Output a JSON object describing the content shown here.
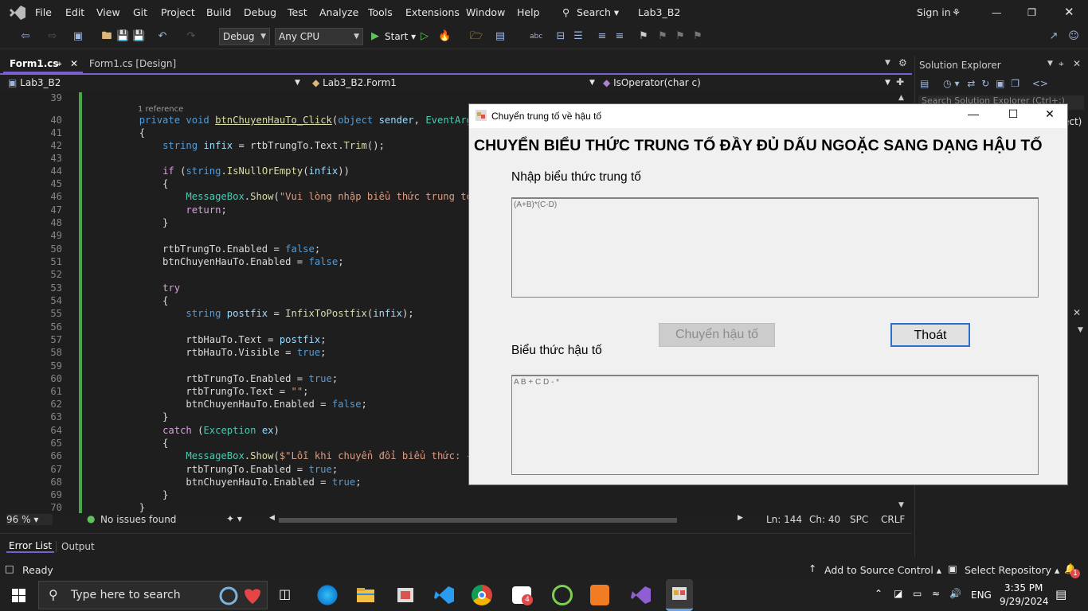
{
  "menubar": {
    "items": [
      "File",
      "Edit",
      "View",
      "Git",
      "Project",
      "Build",
      "Debug",
      "Test",
      "Analyze",
      "Tools",
      "Extensions",
      "Window",
      "Help"
    ],
    "search_label": "Search",
    "solution_name": "Lab3_B2",
    "sign_in": "Sign in"
  },
  "toolbar": {
    "config": "Debug",
    "platform": "Any CPU",
    "start_label": "Start"
  },
  "tabs": {
    "active": "Form1.cs",
    "inactive": "Form1.cs [Design]"
  },
  "nav": {
    "project": "Lab3_B2",
    "class": "Lab3_B2.Form1",
    "member": "IsOperator(char c)"
  },
  "editor": {
    "reference_hint": "1 reference",
    "line_numbers": [
      "39",
      "40",
      "41",
      "42",
      "43",
      "44",
      "45",
      "46",
      "47",
      "48",
      "49",
      "50",
      "51",
      "52",
      "53",
      "54",
      "55",
      "56",
      "57",
      "58",
      "59",
      "60",
      "61",
      "62",
      "63",
      "64",
      "65",
      "66",
      "67",
      "68",
      "69",
      "70"
    ]
  },
  "status_line": {
    "zoom": "96 %",
    "issues": "No issues found",
    "line": "Ln: 144",
    "col": "Ch: 40",
    "spacing": "SPC",
    "eol": "CRLF"
  },
  "panels": {
    "error_list": "Error List",
    "output": "Output"
  },
  "solution_explorer": {
    "title": "Solution Explorer",
    "search_placeholder": "Search Solution Explorer (Ctrl+;)",
    "clipped_text": "ect)"
  },
  "bottom_status": {
    "ready": "Ready",
    "add_source_control": "Add to Source Control",
    "select_repository": "Select Repository",
    "notification_count": "1"
  },
  "taskbar": {
    "search_placeholder": "Type here to search",
    "language": "ENG",
    "time": "3:35 PM",
    "date": "9/29/2024",
    "badge_count": "4"
  },
  "form": {
    "title": "Chuyển trung tố về hậu tố",
    "heading": "CHUYỂN BIỂU THỨC TRUNG TỐ ĐẦY ĐỦ DẤU NGOẶC SANG DẠNG HẬU TỐ",
    "infix_label": "Nhập biểu thức trung tố",
    "infix_value": "(A+B)*(C-D)",
    "convert_button": "Chuyển hậu tố",
    "exit_button": "Thoát",
    "postfix_label": "Biểu thức hậu tố",
    "postfix_value": "A B + C D - *"
  },
  "colors": {
    "accent": "#7a5fd1",
    "editor_bg": "#1e1e1e",
    "change_bar": "#48a848",
    "keyword": "#569cd6",
    "type": "#4ec9b0",
    "method": "#dcdcaa",
    "string": "#d69d85"
  }
}
